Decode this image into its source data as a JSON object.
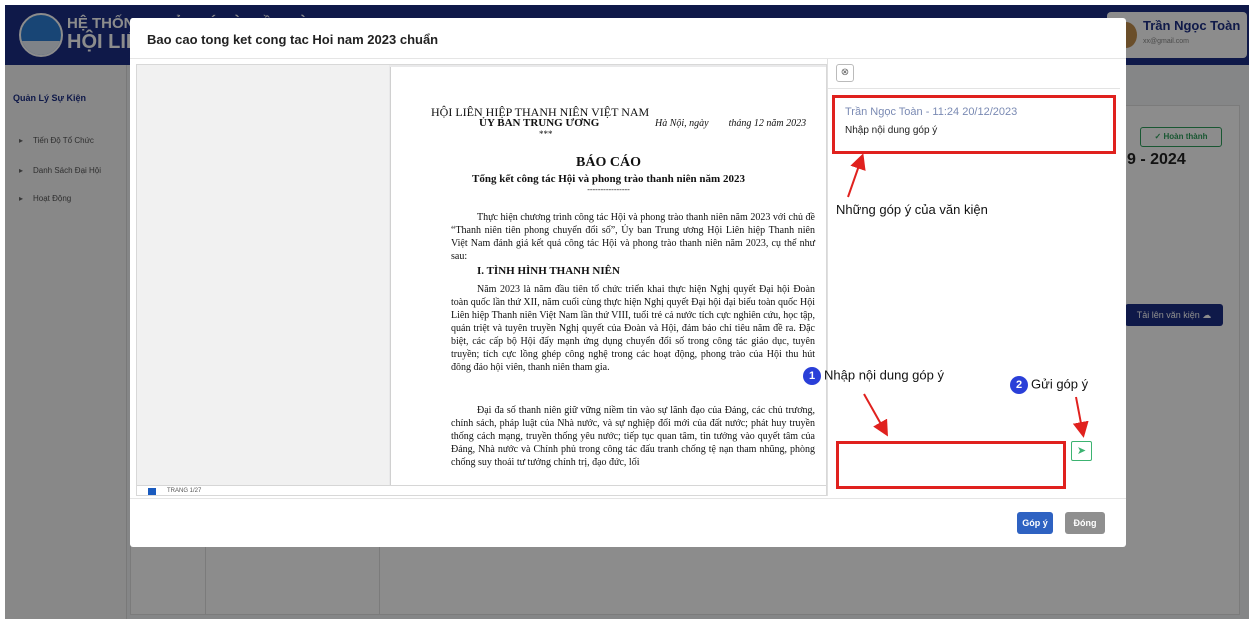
{
  "app": {
    "title_line1": "HỆ THỐNG QUẢN LÝ VÀ ĐIỀU HÀNH",
    "title_line2": "HỘI LIÊN",
    "user_name": "Trần Ngọc Toàn",
    "user_email": "xx@gmail.com"
  },
  "sidebar": {
    "header": "Quản Lý Sự Kiện",
    "items": [
      {
        "label": "Tiến Độ Tổ Chức"
      },
      {
        "label": "Danh Sách Đại Hội"
      },
      {
        "label": "Hoạt Động"
      }
    ]
  },
  "background": {
    "done_label": "Hoàn thành",
    "year_text": "9 - 2024",
    "upload_label": "Tải lên văn kiện"
  },
  "modal": {
    "title": "Bao cao tong ket cong tac Hoi nam 2023 chuẩn",
    "submit_label": "Góp ý",
    "close_label": "Đóng"
  },
  "document": {
    "org_line1": "HỘI LIÊN HIỆP THANH NIÊN VIỆT NAM",
    "org_line2": "ỦY BAN TRUNG ƯƠNG",
    "stars": "***",
    "date_line": "Hà Nội, ngày        tháng 12 năm 2023",
    "title": "BÁO CÁO",
    "subtitle": "Tổng kết công tác Hội và phong trào thanh niên năm 2023",
    "dashes": "----------------",
    "para1": "Thực hiện chương trình công tác Hội và phong trào thanh niên năm 2023 với chủ đề “Thanh niên tiên phong chuyển đổi số”, Ủy ban Trung ương Hội Liên hiệp Thanh niên Việt Nam đánh giá kết quả công tác Hội và phong trào thanh niên năm 2023, cụ thể như sau:",
    "heading1": "I. TÌNH HÌNH THANH NIÊN",
    "para2": "Năm 2023 là năm đầu tiên tổ chức triển khai thực hiện Nghị quyết Đại hội Đoàn toàn quốc lần thứ XII, năm cuối cùng thực hiện Nghị quyết Đại hội đại biểu toàn quốc Hội Liên hiệp Thanh niên Việt Nam lần thứ VIII, tuổi trẻ cả nước tích cực nghiên cứu, học tập, quán triệt và tuyên truyền Nghị quyết của Đoàn và Hội, đảm bảo chỉ tiêu năm đề ra. Đặc biệt, các cấp bộ Hội đẩy mạnh ứng dụng chuyển đổi số trong công tác giáo dục, tuyên truyền; tích cực lồng ghép công nghệ trong các hoạt động, phong trào của Hội thu hút đông đảo hội viên, thanh niên tham gia.",
    "para3": "Đại đa số thanh niên giữ vững niềm tin vào sự lãnh đạo của Đảng, các chủ trương, chính sách, pháp luật của Nhà nước, và sự nghiệp đổi mới của đất nước; phát huy truyền thống cách mạng, truyền thống yêu nước; tiếp tục quan tâm, tin tưởng vào quyết tâm của Đảng, Nhà nước và Chính phủ trong công tác đấu tranh chống tệ nạn tham nhũng, phòng chống suy thoái tư tưởng chính trị, đạo đức, lối",
    "page_indicator": "TRANG 1/27"
  },
  "comments": {
    "items": [
      {
        "author_time": "Trần Ngọc Toàn - 11:24 20/12/2023",
        "text": "Nhập nội dung góp ý"
      }
    ],
    "input_placeholder": ""
  },
  "annotations": {
    "comments_note": "Những góp ý của văn kiện",
    "step1_num": "1",
    "step1_text": "Nhập nội dung góp ý",
    "step2_num": "2",
    "step2_text": "Gửi góp ý",
    "highlight_color": "#e0211e"
  }
}
